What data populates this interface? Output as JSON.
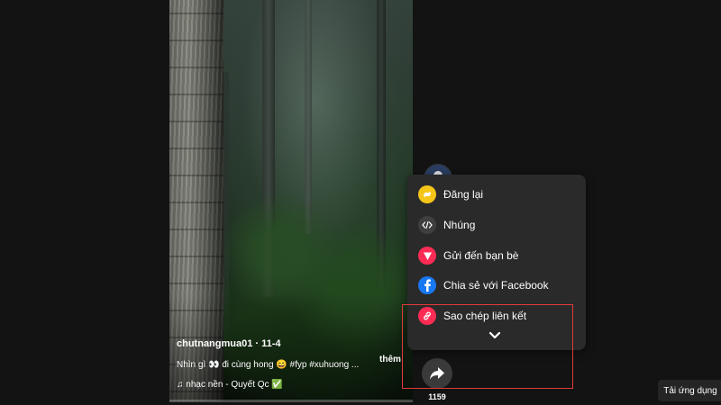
{
  "video": {
    "author": "chutnangmua01 · 11-4",
    "description": "Nhìn gì 👀 đi cùng hong 😄 #fyp #xuhuong ...",
    "more_label": "thêm",
    "music_note": "♫",
    "music": "nhạc nền - Quyết Qc ✅"
  },
  "share": {
    "count": "1159"
  },
  "share_menu": {
    "items": [
      {
        "label": "Đăng lại",
        "icon": "repost-icon",
        "color": "#f5c518"
      },
      {
        "label": "Nhúng",
        "icon": "embed-icon",
        "color": "#3f3f3f"
      },
      {
        "label": "Gửi đến bạn bè",
        "icon": "send-icon",
        "color": "#fe2c55"
      },
      {
        "label": "Chia sẻ với Facebook",
        "icon": "facebook-icon",
        "color": "#1877f2"
      },
      {
        "label": "Sao chép liên kết",
        "icon": "link-icon",
        "color": "#fe2c55"
      }
    ]
  },
  "app_download": {
    "label": "Tải ứng dụng"
  }
}
